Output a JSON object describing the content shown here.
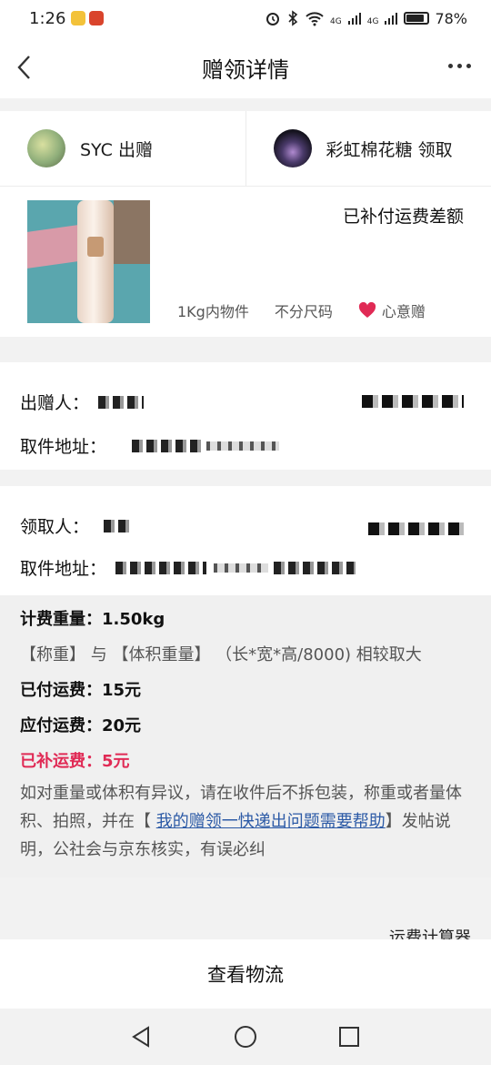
{
  "status_bar": {
    "time": "1:26",
    "battery": "78%",
    "battery_level": 0.78,
    "network_1": "4G",
    "network_2": "4G"
  },
  "header": {
    "title": "赠领详情"
  },
  "parties": {
    "giver": {
      "name": "SYC",
      "action": "出赠"
    },
    "receiver": {
      "name": "彩虹棉花糖",
      "action": "领取"
    }
  },
  "item": {
    "status": "已补付运费差额",
    "tags": [
      "1Kg内物件",
      "不分尺码"
    ],
    "gift_label": "心意赠"
  },
  "sender": {
    "person_label": "出赠人：",
    "address_label": "取件地址："
  },
  "recipient": {
    "person_label": "领取人：",
    "address_label": "取件地址："
  },
  "fees": {
    "weight_label": "计费重量：",
    "weight_value": "1.50kg",
    "rule": "【称重】 与 【体积重量】 （长*宽*高/8000) 相较取大",
    "paid_label": "已付运费：",
    "paid_value": "15元",
    "due_label": "应付运费：",
    "due_value": "20元",
    "topup_label": "已补运费：",
    "topup_value": "5元",
    "note_before": "如对重量或体积有异议，请在收件后不拆包装，称重或者量体积、拍照，并在【 ",
    "note_link": "我的赠领一快递出问题需要帮助",
    "note_after": "】发帖说明，公社会与京东核实，有误必纠"
  },
  "calculator": {
    "label": "运费计算器"
  },
  "actions": {
    "logistics": "查看物流"
  },
  "colors": {
    "accent_red": "#e02a55",
    "link_blue": "#2c5aa6"
  }
}
